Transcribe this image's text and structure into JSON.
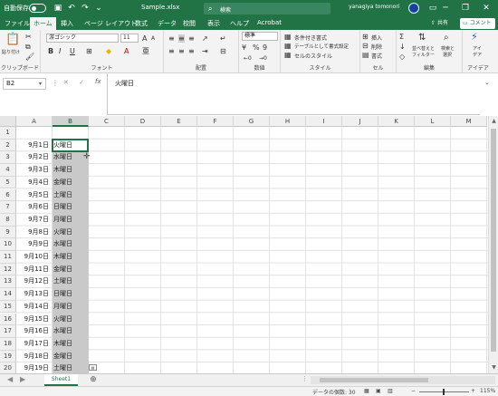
{
  "titlebar": {
    "autosave_label": "自動保存",
    "autosave_state": "オフ",
    "filename": "Sample.xlsx",
    "search_placeholder": "検索",
    "username": "yanagiya tomonori"
  },
  "menu": {
    "items": [
      "ファイル",
      "ホーム",
      "挿入",
      "ページ レイアウト",
      "数式",
      "データ",
      "校閲",
      "表示",
      "ヘルプ",
      "Acrobat"
    ],
    "active": "ホーム",
    "share_label": "共有",
    "comment_label": "コメント"
  },
  "ribbon": {
    "clipboard": {
      "label": "クリップボード",
      "paste_label": "貼り付け"
    },
    "font": {
      "label": "フォント",
      "font_name": "游ゴシック",
      "font_size": "11"
    },
    "alignment": {
      "label": "配置"
    },
    "number": {
      "label": "数値",
      "format": "標準"
    },
    "styles": {
      "label": "スタイル",
      "conditional": "条件付き書式",
      "table": "テーブルとして書式設定",
      "cell_styles": "セルのスタイル"
    },
    "cells": {
      "label": "セル",
      "insert": "挿入",
      "delete": "削除",
      "format": "書式"
    },
    "editing": {
      "label": "編集",
      "sort": "並べ替えと",
      "sort2": "フィルター",
      "find": "検索と",
      "find2": "選択"
    },
    "ideas": {
      "label": "アイデア",
      "btn": "アイ",
      "btn2": "デア"
    }
  },
  "formula": {
    "namebox": "B2",
    "fx": "fx",
    "value": "火曜日"
  },
  "columns": [
    "A",
    "B",
    "C",
    "D",
    "E",
    "F",
    "G",
    "H",
    "I",
    "J",
    "K",
    "L",
    "M"
  ],
  "selected_column": "B",
  "rows": [
    "1",
    "2",
    "3",
    "4",
    "5",
    "6",
    "7",
    "8",
    "9",
    "10",
    "11",
    "12",
    "13",
    "14",
    "15",
    "16",
    "17",
    "18",
    "19",
    "20"
  ],
  "data": [
    {
      "a": "",
      "b": ""
    },
    {
      "a": "9月1日",
      "b": "火曜日"
    },
    {
      "a": "9月2日",
      "b": "水曜日"
    },
    {
      "a": "9月3日",
      "b": "木曜日"
    },
    {
      "a": "9月4日",
      "b": "金曜日"
    },
    {
      "a": "9月5日",
      "b": "土曜日"
    },
    {
      "a": "9月6日",
      "b": "日曜日"
    },
    {
      "a": "9月7日",
      "b": "月曜日"
    },
    {
      "a": "9月8日",
      "b": "火曜日"
    },
    {
      "a": "9月9日",
      "b": "水曜日"
    },
    {
      "a": "9月10日",
      "b": "木曜日"
    },
    {
      "a": "9月11日",
      "b": "金曜日"
    },
    {
      "a": "9月12日",
      "b": "土曜日"
    },
    {
      "a": "9月13日",
      "b": "日曜日"
    },
    {
      "a": "9月14日",
      "b": "月曜日"
    },
    {
      "a": "9月15日",
      "b": "火曜日"
    },
    {
      "a": "9月16日",
      "b": "水曜日"
    },
    {
      "a": "9月17日",
      "b": "木曜日"
    },
    {
      "a": "9月18日",
      "b": "金曜日"
    },
    {
      "a": "9月19日",
      "b": "土曜日"
    }
  ],
  "sheet": {
    "name": "Sheet1"
  },
  "status": {
    "count_label": "データの個数: 30",
    "zoom": "115%"
  },
  "colors": {
    "accent": "#217346",
    "selection": "#c9c9c9"
  }
}
